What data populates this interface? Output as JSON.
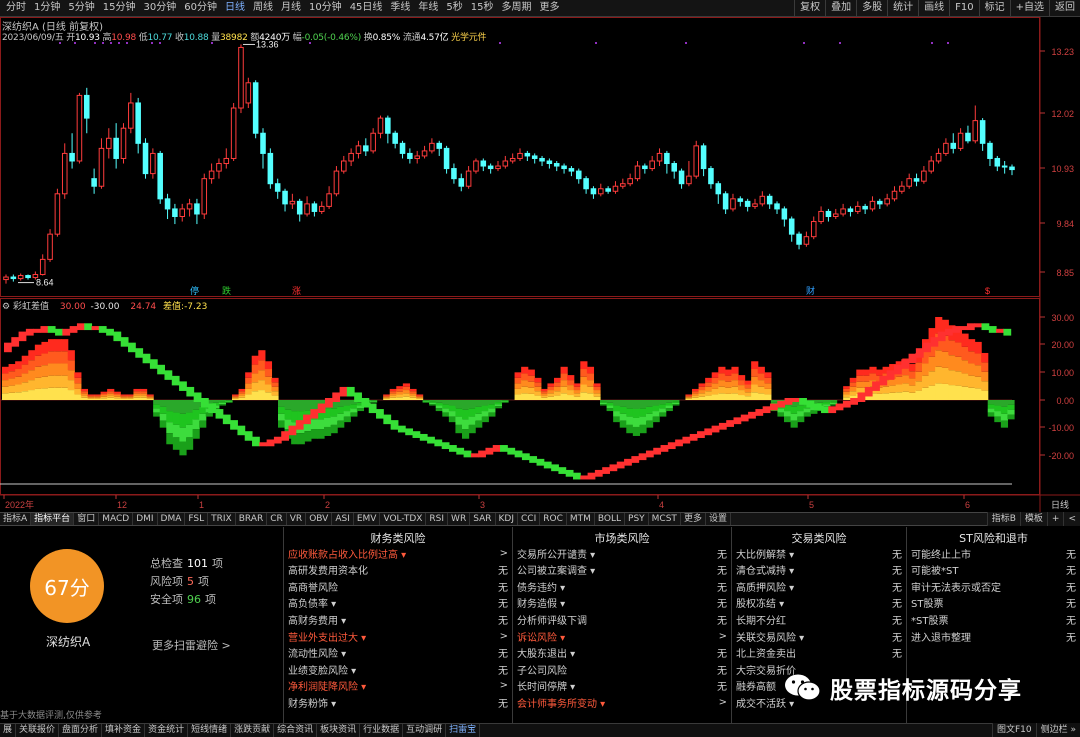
{
  "top_periods": [
    "分时",
    "1分钟",
    "5分钟",
    "15分钟",
    "30分钟",
    "60分钟",
    "日线",
    "周线",
    "月线",
    "10分钟",
    "45日线",
    "季线",
    "年线",
    "5秒",
    "15秒",
    "多周期",
    "更多"
  ],
  "top_selected": 6,
  "top_tools": [
    "复权",
    "叠加",
    "多股",
    "统计",
    "画线",
    "F10",
    "标记",
    "+自选",
    "返回"
  ],
  "info_line": "深纺织A (日线 前复权)",
  "quote": {
    "date": "2023/06/09/五",
    "open_label": "开",
    "open": "10.93",
    "high_label": "高",
    "high": "10.98",
    "low_label": "低",
    "low": "10.77",
    "close_label": "收",
    "close": "10.88",
    "vol_label": "量",
    "vol": "38982",
    "amt_label": "额",
    "amt": "4240万",
    "chg_label": "幅",
    "chg": "-0.05(-0.46%)",
    "turn_label": "换",
    "turn": "0.85%",
    "float_label": "流通",
    "float": "4.57亿",
    "concept": "光学元件"
  },
  "price_axis": [
    "13.23",
    "12.02",
    "10.93",
    "9.84",
    "8.85"
  ],
  "high_marker": "13.36",
  "low_marker": "8.64",
  "event_marks": [
    "停",
    "跌",
    "涨",
    "财",
    "$"
  ],
  "indicator": {
    "name": "彩虹差值",
    "v1": "30.00",
    "v2": "-30.00",
    "v3": "24.74",
    "diff_label": "差值:",
    "diff": "-7.23",
    "axis": [
      "30.00",
      "20.00",
      "10.00",
      "0.00",
      "-10.00",
      "-20.00"
    ]
  },
  "time_axis": [
    "2022年",
    "12",
    "1",
    "2",
    "3",
    "4",
    "5",
    "6"
  ],
  "time_unit": "日线",
  "indicator_tabs": [
    "指标A",
    "指标平台",
    "窗口",
    "MACD",
    "DMI",
    "DMA",
    "FSL",
    "TRIX",
    "BRAR",
    "CR",
    "VR",
    "OBV",
    "ASI",
    "EMV",
    "VOL-TDX",
    "RSI",
    "WR",
    "SAR",
    "KDJ",
    "CCI",
    "ROC",
    "MTM",
    "BOLL",
    "PSY",
    "MCST",
    "更多",
    "设置"
  ],
  "indicator_tabs_selected": 1,
  "indicator_right": [
    "指标B",
    "模板",
    "+",
    "<"
  ],
  "scan": {
    "score": "67分",
    "stock": "深纺织A",
    "total_label": "总检查",
    "total": "101",
    "total_unit": "项",
    "risk_label": "风险项",
    "risk": "5",
    "risk_unit": "项",
    "safe_label": "安全项",
    "safe": "96",
    "safe_unit": "项",
    "more": "更多扫雷避险 >"
  },
  "risk_columns": [
    {
      "title": "财务类风险",
      "items": [
        {
          "label": "应收账款占收入比例过高 ▾",
          "value": ">",
          "alert": true
        },
        {
          "label": "高研发费用资本化",
          "value": "无",
          "alert": false
        },
        {
          "label": "高商誉风险",
          "value": "无",
          "alert": false
        },
        {
          "label": "高负债率 ▾",
          "value": "无",
          "alert": false
        },
        {
          "label": "高财务费用 ▾",
          "value": "无",
          "alert": false
        },
        {
          "label": "营业外支出过大 ▾",
          "value": ">",
          "alert": true
        },
        {
          "label": "流动性风险 ▾",
          "value": "无",
          "alert": false
        },
        {
          "label": "业绩变脸风险 ▾",
          "value": "无",
          "alert": false
        },
        {
          "label": "净利润陡降风险 ▾",
          "value": ">",
          "alert": true
        },
        {
          "label": "财务粉饰 ▾",
          "value": "无",
          "alert": false
        }
      ]
    },
    {
      "title": "市场类风险",
      "items": [
        {
          "label": "交易所公开谴责 ▾",
          "value": "无",
          "alert": false
        },
        {
          "label": "公司被立案调查 ▾",
          "value": "无",
          "alert": false
        },
        {
          "label": "债务违约 ▾",
          "value": "无",
          "alert": false
        },
        {
          "label": "财务造假 ▾",
          "value": "无",
          "alert": false
        },
        {
          "label": "分析师评级下调",
          "value": "无",
          "alert": false
        },
        {
          "label": "诉讼风险 ▾",
          "value": ">",
          "alert": true
        },
        {
          "label": "大股东退出 ▾",
          "value": "无",
          "alert": false
        },
        {
          "label": "子公司风险",
          "value": "无",
          "alert": false
        },
        {
          "label": "长时间停牌 ▾",
          "value": "无",
          "alert": false
        },
        {
          "label": "会计师事务所变动 ▾",
          "value": ">",
          "alert": true
        }
      ]
    },
    {
      "title": "交易类风险",
      "items": [
        {
          "label": "大比例解禁 ▾",
          "value": "无",
          "alert": false
        },
        {
          "label": "清仓式减持 ▾",
          "value": "无",
          "alert": false
        },
        {
          "label": "高质押风险 ▾",
          "value": "无",
          "alert": false
        },
        {
          "label": "股权冻结 ▾",
          "value": "无",
          "alert": false
        },
        {
          "label": "长期不分红",
          "value": "无",
          "alert": false
        },
        {
          "label": "关联交易风险 ▾",
          "value": "无",
          "alert": false
        },
        {
          "label": "北上资金卖出",
          "value": "无",
          "alert": false
        },
        {
          "label": "大宗交易折价",
          "value": "",
          "alert": false
        },
        {
          "label": "融券高额",
          "value": "",
          "alert": false
        },
        {
          "label": "成交不活跃 ▾",
          "value": "",
          "alert": false
        }
      ]
    },
    {
      "title": "ST风险和退市",
      "items": [
        {
          "label": "可能终止上市",
          "value": "无",
          "alert": false
        },
        {
          "label": "可能被*ST",
          "value": "无",
          "alert": false
        },
        {
          "label": "审计无法表示或否定",
          "value": "无",
          "alert": false
        },
        {
          "label": "ST股票",
          "value": "无",
          "alert": false
        },
        {
          "label": "*ST股票",
          "value": "无",
          "alert": false
        },
        {
          "label": "进入退市整理",
          "value": "无",
          "alert": false
        }
      ]
    }
  ],
  "disclaimer": "基于大数据评测,仅供参考",
  "watermark": "股票指标源码分享",
  "status_tabs": [
    "展",
    "关联报价",
    "盘面分析",
    "填补资金",
    "资金统计",
    "短线情绪",
    "涨跌贡献",
    "综合资讯",
    "板块资讯",
    "行业数据",
    "互动调研",
    "扫雷宝"
  ],
  "status_selected": 11,
  "status_right": [
    "图文F10",
    "侧边栏 »"
  ],
  "colors": {
    "up": "#ff3c3c",
    "down": "#54ffff",
    "accent": "#f29425",
    "frame": "#8b1a1a"
  }
}
